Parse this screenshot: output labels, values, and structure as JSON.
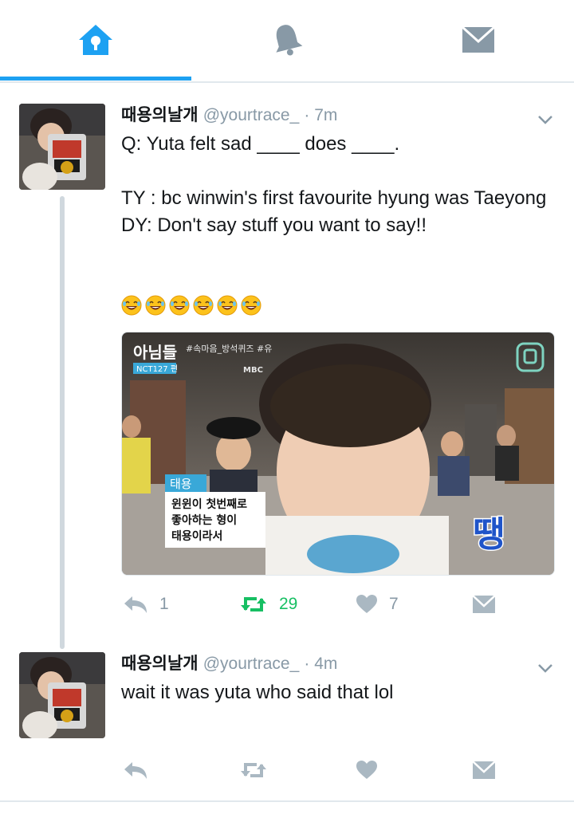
{
  "tabs": [
    {
      "name": "home",
      "icon": "home-icon",
      "active": true
    },
    {
      "name": "notifications",
      "icon": "bell-icon",
      "active": false
    },
    {
      "name": "messages",
      "icon": "envelope-icon",
      "active": false
    }
  ],
  "colors": {
    "accent": "#1da1f2",
    "muted": "#8899a6",
    "retweet": "#17bf63",
    "divider": "#e1e8ed"
  },
  "tweets": [
    {
      "name": "때용의날개",
      "handle": "@yourtrace_",
      "time": "· 7m",
      "text": "Q: Yuta felt sad ____ does ____.\n\nTY : bc winwin's first favourite hyung was Taeyong\nDY: Don't say stuff you want to say!!",
      "emoji_count": 6,
      "media": {
        "show_title": "아님들",
        "hashtags": "#속마음_방석퀴즈 #유",
        "show_sub": "NCT127 편",
        "channel": "MBC",
        "name_tag": "태용",
        "caption": [
          "윈윈이 첫번째로",
          "좋아하는 형이",
          "태용이라서"
        ],
        "sfx": "땡"
      },
      "replies": "1",
      "retweets": "29",
      "likes": "7"
    },
    {
      "name": "때용의날개",
      "handle": "@yourtrace_",
      "time": "· 4m",
      "text": "wait it was yuta who said that lol",
      "replies": "",
      "retweets": "",
      "likes": ""
    }
  ]
}
